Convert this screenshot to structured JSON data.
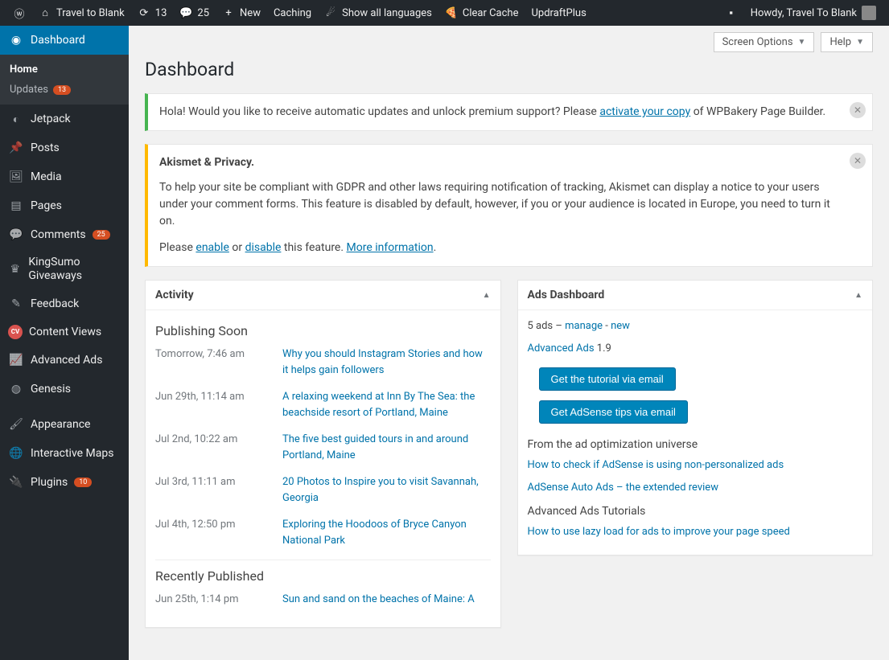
{
  "adminbar": {
    "site_name": "Travel to Blank",
    "refresh_count": "13",
    "comments_count": "25",
    "new_label": "New",
    "caching_label": "Caching",
    "show_lang_label": "Show all languages",
    "clear_cache_label": "Clear Cache",
    "updraft_label": "UpdraftPlus",
    "howdy_label": "Howdy, Travel To Blank"
  },
  "sidebar": {
    "dashboard": "Dashboard",
    "home": "Home",
    "updates": "Updates",
    "updates_count": "13",
    "jetpack": "Jetpack",
    "posts": "Posts",
    "media": "Media",
    "pages": "Pages",
    "comments": "Comments",
    "comments_count": "25",
    "kingsumo": "KingSumo Giveaways",
    "feedback": "Feedback",
    "content_views": "Content Views",
    "advanced_ads": "Advanced Ads",
    "genesis": "Genesis",
    "appearance": "Appearance",
    "interactive_maps": "Interactive Maps",
    "plugins": "Plugins",
    "plugins_count": "10"
  },
  "top": {
    "screen_options": "Screen Options",
    "help": "Help"
  },
  "page_title": "Dashboard",
  "notice1": {
    "text_before": "Hola! Would you like to receive automatic updates and unlock premium support? Please ",
    "link": "activate your copy",
    "text_after": " of WPBakery Page Builder."
  },
  "notice2": {
    "heading": "Akismet & Privacy.",
    "para": "To help your site be compliant with GDPR and other laws requiring notification of tracking, Akismet can display a notice to your users under your comment forms. This feature is disabled by default, however, if you or your audience is located in Europe, you need to turn it on.",
    "please": "Please ",
    "enable": "enable",
    "or": " or ",
    "disable": "disable",
    "feature": " this feature. ",
    "more": "More information"
  },
  "activity": {
    "title": "Activity",
    "publishing_soon": "Publishing Soon",
    "items": [
      {
        "when": "Tomorrow, 7:46 am",
        "title": "Why you should Instagram Stories and how it helps gain followers"
      },
      {
        "when": "Jun 29th, 11:14 am",
        "title": "A relaxing weekend at Inn By The Sea: the beachside resort of Portland, Maine"
      },
      {
        "when": "Jul 2nd, 10:22 am",
        "title": "The five best guided tours in and around Portland, Maine"
      },
      {
        "when": "Jul 3rd, 11:11 am",
        "title": "20 Photos to Inspire you to visit Savannah, Georgia"
      },
      {
        "when": "Jul 4th, 12:50 pm",
        "title": "Exploring the Hoodoos of Bryce Canyon National Park"
      }
    ],
    "recently_published": "Recently Published",
    "recent_items": [
      {
        "when": "Jun 25th, 1:14 pm",
        "title": "Sun and sand on the beaches of Maine: A"
      }
    ]
  },
  "ads": {
    "title": "Ads Dashboard",
    "count_prefix": "5 ads – ",
    "manage": "manage",
    "sep": " - ",
    "new": "new",
    "adv_ads": "Advanced Ads",
    "version": " 1.9",
    "btn1": "Get the tutorial via email",
    "btn2": "Get AdSense tips via email",
    "h1": "From the ad optimization universe",
    "link1": "How to check if AdSense is using non-personalized ads",
    "link2": "AdSense Auto Ads – the extended review",
    "h2": "Advanced Ads Tutorials",
    "link3": "How to use lazy load for ads to improve your page speed"
  }
}
